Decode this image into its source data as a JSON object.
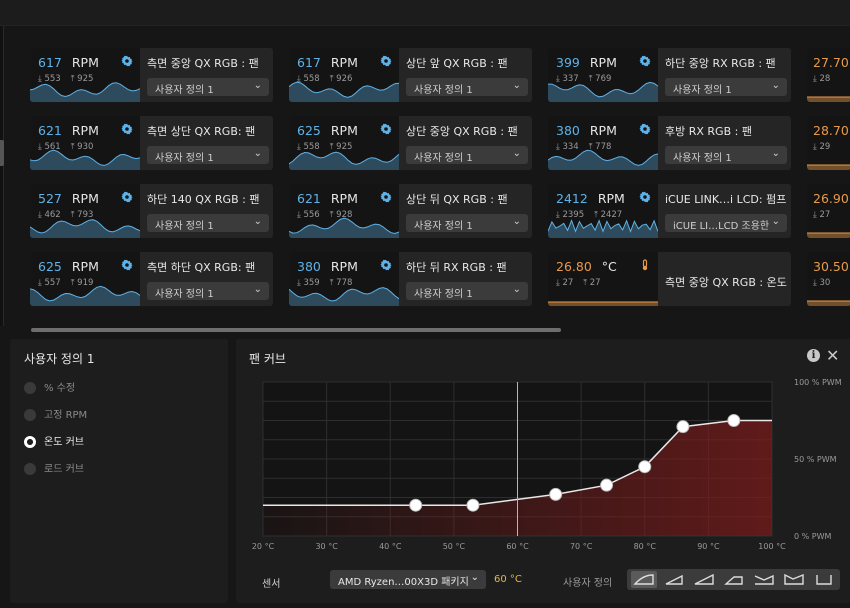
{
  "cards": [
    {
      "id": "c1",
      "value": "617",
      "unit": "RPM",
      "min": "553",
      "max": "925",
      "title": "측면 중앙  QX RGB : 팬",
      "select": "사용자 정의 1",
      "kind": "fan"
    },
    {
      "id": "c2",
      "value": "621",
      "unit": "RPM",
      "min": "561",
      "max": "930",
      "title": "측면 상단 QX RGB: 팬",
      "select": "사용자 정의 1",
      "kind": "fan"
    },
    {
      "id": "c3",
      "value": "527",
      "unit": "RPM",
      "min": "462",
      "max": "793",
      "title": "하단 140 QX RGB : 팬",
      "select": "사용자 정의 1",
      "kind": "fan"
    },
    {
      "id": "c4",
      "value": "625",
      "unit": "RPM",
      "min": "557",
      "max": "919",
      "title": "측면 하단 QX RGB: 팬",
      "select": "사용자 정의 1",
      "kind": "fan"
    },
    {
      "id": "c5",
      "value": "617",
      "unit": "RPM",
      "min": "558",
      "max": "926",
      "title": "상단 앞 QX RGB : 팬",
      "select": "사용자 정의 1",
      "kind": "fan"
    },
    {
      "id": "c6",
      "value": "625",
      "unit": "RPM",
      "min": "558",
      "max": "925",
      "title": "상단 중앙 QX RGB : 팬",
      "select": "사용자 정의 1",
      "kind": "fan"
    },
    {
      "id": "c7",
      "value": "621",
      "unit": "RPM",
      "min": "556",
      "max": "928",
      "title": "상단 뒤 QX RGB : 팬",
      "select": "사용자 정의 1",
      "kind": "fan"
    },
    {
      "id": "c8",
      "value": "380",
      "unit": "RPM",
      "min": "359",
      "max": "778",
      "title": "하단 뒤 RX RGB : 팬",
      "select": "사용자 정의 1",
      "kind": "fan"
    },
    {
      "id": "c9",
      "value": "399",
      "unit": "RPM",
      "min": "337",
      "max": "769",
      "title": "하단 중앙 RX RGB : 팬",
      "select": "사용자 정의 1",
      "kind": "fan"
    },
    {
      "id": "c10",
      "value": "380",
      "unit": "RPM",
      "min": "334",
      "max": "778",
      "title": "후방  RX RGB : 팬",
      "select": "사용자 정의 1",
      "kind": "fan"
    },
    {
      "id": "c11",
      "value": "2412",
      "unit": "RPM",
      "min": "2395",
      "max": "2427",
      "title": "iCUE LINK…i LCD: 펌프",
      "select": "iCUE LI…LCD 조용한",
      "kind": "pump"
    },
    {
      "id": "c12",
      "value": "26.80",
      "unit": "°C",
      "min": "27",
      "max": "27",
      "title": "측면 중앙  QX RGB : 온도",
      "kind": "temp"
    }
  ],
  "partial_cards": [
    {
      "value": "27.70",
      "min": "28"
    },
    {
      "value": "28.70",
      "min": "29"
    },
    {
      "value": "26.90",
      "min": "27"
    },
    {
      "value": "30.50",
      "min": "30"
    }
  ],
  "left_panel": {
    "title": "사용자 정의 1",
    "options": [
      {
        "label": "% 수정",
        "selected": false
      },
      {
        "label": "고정 RPM",
        "selected": false
      },
      {
        "label": "온도 커브",
        "selected": true
      },
      {
        "label": "로드 커브",
        "selected": false
      }
    ]
  },
  "right_panel": {
    "title": "팬 커브",
    "info_icon": "info-icon",
    "close_icon": "close-icon"
  },
  "chart_data": {
    "type": "line",
    "title": "",
    "xlabel": "",
    "ylabel": "",
    "x_ticks": [
      "20 °C",
      "30 °C",
      "40 °C",
      "50 °C",
      "60 °C",
      "70 °C",
      "80 °C",
      "90 °C",
      "100 °C"
    ],
    "y_ticks": [
      "100 % PWM",
      "50 % PWM",
      "0 % PWM"
    ],
    "xlim": [
      20,
      100
    ],
    "ylim": [
      0,
      100
    ],
    "current_temp": 60,
    "series": [
      {
        "x": [
          20,
          44,
          53,
          66,
          74,
          80,
          86,
          94,
          100
        ],
        "y": [
          20,
          20,
          20,
          27,
          33,
          45,
          71,
          75,
          75
        ]
      }
    ],
    "control_points": [
      [
        44,
        20
      ],
      [
        53,
        20
      ],
      [
        66,
        27
      ],
      [
        74,
        33
      ],
      [
        80,
        45
      ],
      [
        86,
        71
      ],
      [
        94,
        75
      ]
    ],
    "line_color": "#e8e8e8",
    "fill_color": "#7a1c1c",
    "marker_color": "#e0b84a"
  },
  "sensor": {
    "label": "센서",
    "selected": "AMD Ryzen…00X3D 패키지",
    "temp": "60 °C"
  },
  "preset": {
    "label": "사용자 정의",
    "active_index": 0,
    "icons": [
      "preset-quiet-icon",
      "preset-balanced-icon",
      "preset-extreme-icon",
      "preset-zero-rpm-icon",
      "preset-fixed-50-icon",
      "preset-fixed-100-icon",
      "preset-reset-icon"
    ]
  },
  "colors": {
    "rpm": "#5fb2e8",
    "temp": "#e79a4a",
    "accent": "#e0b84a"
  }
}
